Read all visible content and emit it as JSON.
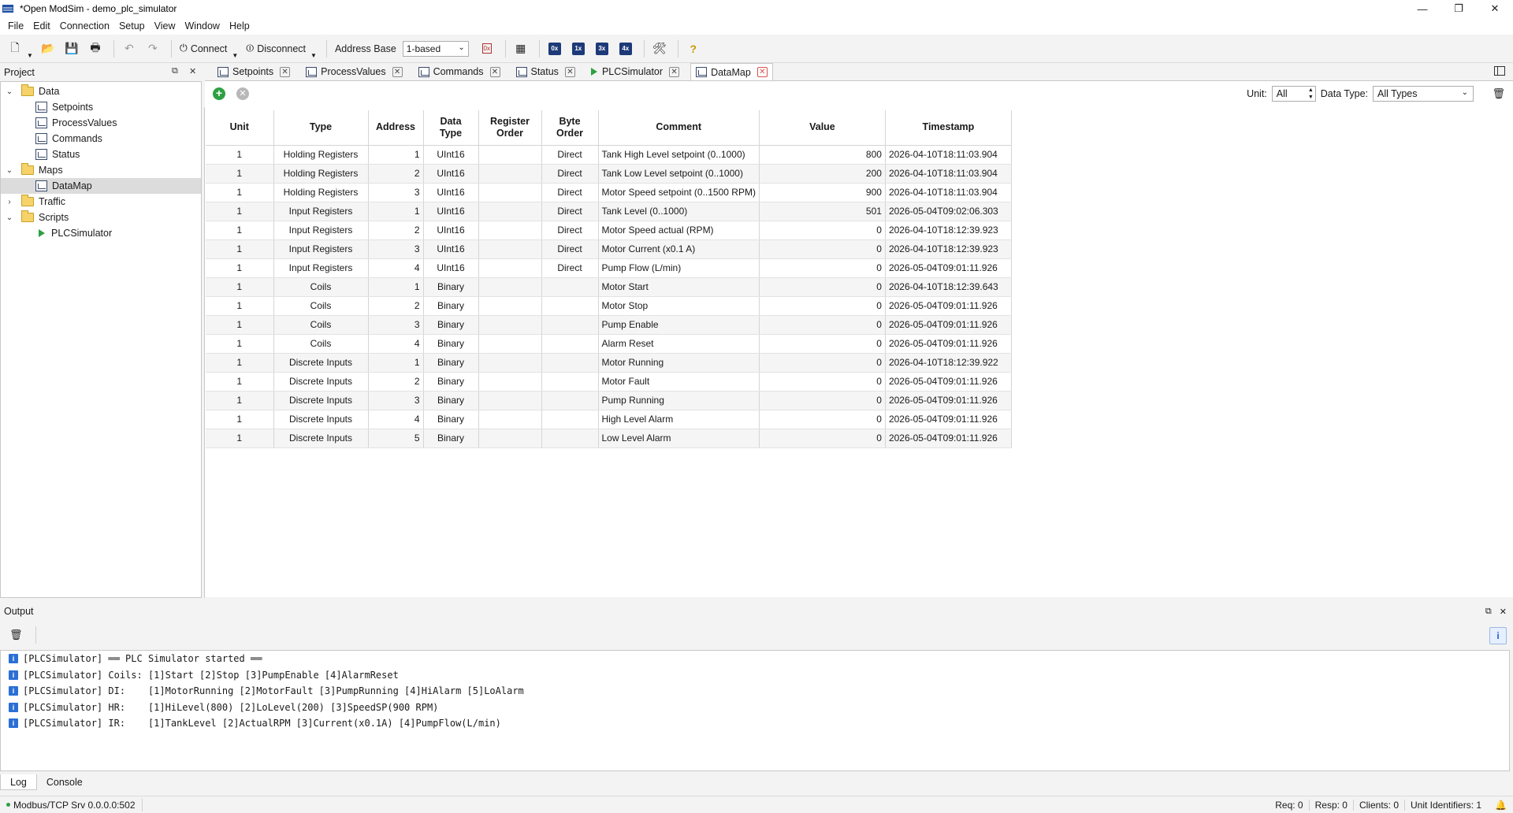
{
  "window": {
    "title": "*Open ModSim - demo_plc_simulator",
    "controls": {
      "minimize": "—",
      "maximize": "❐",
      "close": "✕"
    }
  },
  "menu": [
    "File",
    "Edit",
    "Connection",
    "Setup",
    "View",
    "Window",
    "Help"
  ],
  "toolbar": {
    "connect": "Connect",
    "disconnect": "Disconnect",
    "address_base_label": "Address Base",
    "address_base_value": "1-based",
    "register_buttons": [
      "0x",
      "1x",
      "3x",
      "4x"
    ]
  },
  "project": {
    "title": "Project",
    "tree": [
      {
        "label": "Data",
        "level": 0,
        "kind": "folder",
        "expanded": true
      },
      {
        "label": "Setpoints",
        "level": 1,
        "kind": "doc"
      },
      {
        "label": "ProcessValues",
        "level": 1,
        "kind": "doc"
      },
      {
        "label": "Commands",
        "level": 1,
        "kind": "doc"
      },
      {
        "label": "Status",
        "level": 1,
        "kind": "doc"
      },
      {
        "label": "Maps",
        "level": 0,
        "kind": "folder",
        "expanded": true
      },
      {
        "label": "DataMap",
        "level": 1,
        "kind": "doc",
        "selected": true
      },
      {
        "label": "Traffic",
        "level": 0,
        "kind": "folder",
        "expanded": false
      },
      {
        "label": "Scripts",
        "level": 0,
        "kind": "folder",
        "expanded": true
      },
      {
        "label": "PLCSimulator",
        "level": 1,
        "kind": "script"
      }
    ]
  },
  "tabs": [
    {
      "label": "Setpoints",
      "kind": "doc",
      "active": false
    },
    {
      "label": "ProcessValues",
      "kind": "doc",
      "active": false
    },
    {
      "label": "Commands",
      "kind": "doc",
      "active": false
    },
    {
      "label": "Status",
      "kind": "doc",
      "active": false
    },
    {
      "label": "PLCSimulator",
      "kind": "script",
      "active": false
    },
    {
      "label": "DataMap",
      "kind": "doc",
      "active": true
    }
  ],
  "filters": {
    "unit_label": "Unit:",
    "unit_value": "All",
    "type_label": "Data Type:",
    "type_value": "All Types"
  },
  "table": {
    "columns": [
      "Unit",
      "Type",
      "Address",
      "Data Type",
      "Register Order",
      "Byte Order",
      "Comment",
      "Value",
      "Timestamp"
    ],
    "rows": [
      [
        "1",
        "Holding Registers",
        "1",
        "UInt16",
        "",
        "Direct",
        "Tank High Level setpoint (0..1000)",
        "800",
        "2026-04-10T18:11:03.904"
      ],
      [
        "1",
        "Holding Registers",
        "2",
        "UInt16",
        "",
        "Direct",
        "Tank Low Level setpoint (0..1000)",
        "200",
        "2026-04-10T18:11:03.904"
      ],
      [
        "1",
        "Holding Registers",
        "3",
        "UInt16",
        "",
        "Direct",
        "Motor Speed setpoint (0..1500 RPM)",
        "900",
        "2026-04-10T18:11:03.904"
      ],
      [
        "1",
        "Input Registers",
        "1",
        "UInt16",
        "",
        "Direct",
        "Tank Level (0..1000)",
        "501",
        "2026-05-04T09:02:06.303"
      ],
      [
        "1",
        "Input Registers",
        "2",
        "UInt16",
        "",
        "Direct",
        "Motor Speed actual (RPM)",
        "0",
        "2026-04-10T18:12:39.923"
      ],
      [
        "1",
        "Input Registers",
        "3",
        "UInt16",
        "",
        "Direct",
        "Motor Current (x0.1 A)",
        "0",
        "2026-04-10T18:12:39.923"
      ],
      [
        "1",
        "Input Registers",
        "4",
        "UInt16",
        "",
        "Direct",
        "Pump Flow (L/min)",
        "0",
        "2026-05-04T09:01:11.926"
      ],
      [
        "1",
        "Coils",
        "1",
        "Binary",
        "",
        "",
        "Motor Start",
        "0",
        "2026-04-10T18:12:39.643"
      ],
      [
        "1",
        "Coils",
        "2",
        "Binary",
        "",
        "",
        "Motor Stop",
        "0",
        "2026-05-04T09:01:11.926"
      ],
      [
        "1",
        "Coils",
        "3",
        "Binary",
        "",
        "",
        "Pump Enable",
        "0",
        "2026-05-04T09:01:11.926"
      ],
      [
        "1",
        "Coils",
        "4",
        "Binary",
        "",
        "",
        "Alarm Reset",
        "0",
        "2026-05-04T09:01:11.926"
      ],
      [
        "1",
        "Discrete Inputs",
        "1",
        "Binary",
        "",
        "",
        "Motor Running",
        "0",
        "2026-04-10T18:12:39.922"
      ],
      [
        "1",
        "Discrete Inputs",
        "2",
        "Binary",
        "",
        "",
        "Motor Fault",
        "0",
        "2026-05-04T09:01:11.926"
      ],
      [
        "1",
        "Discrete Inputs",
        "3",
        "Binary",
        "",
        "",
        "Pump Running",
        "0",
        "2026-05-04T09:01:11.926"
      ],
      [
        "1",
        "Discrete Inputs",
        "4",
        "Binary",
        "",
        "",
        "High Level Alarm",
        "0",
        "2026-05-04T09:01:11.926"
      ],
      [
        "1",
        "Discrete Inputs",
        "5",
        "Binary",
        "",
        "",
        "Low Level Alarm",
        "0",
        "2026-05-04T09:01:11.926"
      ]
    ]
  },
  "output": {
    "title": "Output",
    "info_toggle": "i",
    "lines": [
      "[PLCSimulator] ══ PLC Simulator started ══",
      "[PLCSimulator] Coils: [1]Start [2]Stop [3]PumpEnable [4]AlarmReset",
      "[PLCSimulator] DI:    [1]MotorRunning [2]MotorFault [3]PumpRunning [4]HiAlarm [5]LoAlarm",
      "[PLCSimulator] HR:    [1]HiLevel(800) [2]LoLevel(200) [3]SpeedSP(900 RPM)",
      "[PLCSimulator] IR:    [1]TankLevel [2]ActualRPM [3]Current(x0.1A) [4]PumpFlow(L/min)"
    ],
    "tabs": [
      "Log",
      "Console"
    ]
  },
  "status": {
    "connection": "Modbus/TCP Srv 0.0.0.0:502",
    "req": "Req: 0",
    "resp": "Resp: 0",
    "clients": "Clients: 0",
    "unit_ids": "Unit Identifiers: 1"
  },
  "colors": {
    "accent": "#2a6fd6",
    "ok": "#2ea043",
    "close_active": "#d9534f"
  }
}
